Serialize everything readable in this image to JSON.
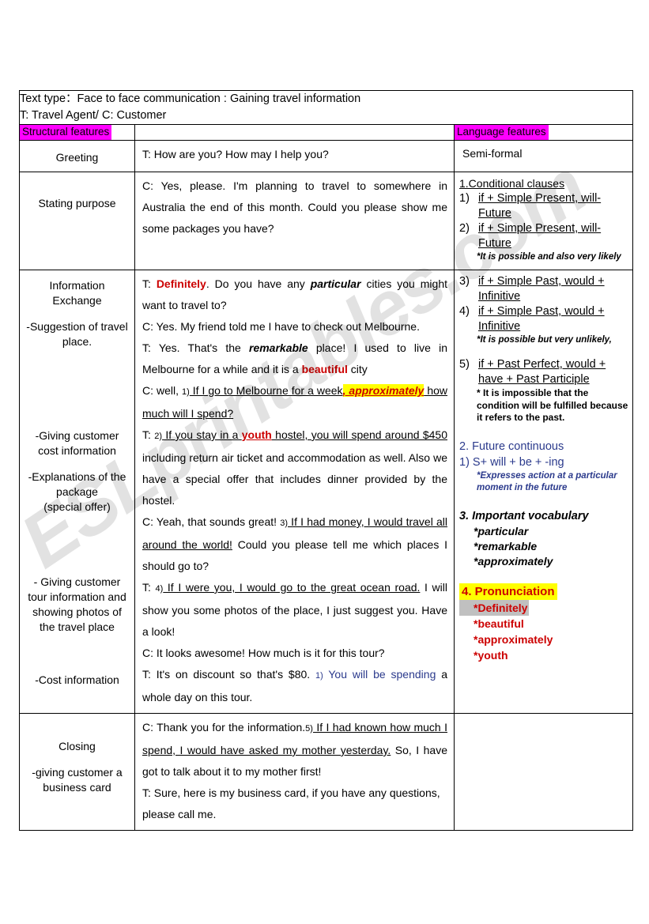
{
  "watermark": {
    "text": "ESLprintables.com"
  },
  "header": {
    "line1": "Text type：Face to face communication : Gaining travel information",
    "line2": "T: Travel Agent/ C: Customer"
  },
  "column_headers": {
    "structural": "Structural features",
    "language": "Language features",
    "highlight_color": "#FF00FF"
  },
  "rows": {
    "greeting": {
      "structural": "Greeting",
      "dialogue": "T: How are you? How may I help you?",
      "language": "Semi-formal"
    },
    "stating_purpose": {
      "structural": "Stating purpose",
      "dialogue": "C: Yes, please. I'm planning to travel to somewhere in Australia the end of this month. Could you please show me some packages you have?"
    },
    "information_exchange": {
      "structural": {
        "title_line1": "Information",
        "title_line2": "Exchange",
        "item1_line1": "-Suggestion of travel",
        "item1_line2": "place.",
        "item2_line1": "-Giving customer",
        "item2_line2": "cost information",
        "item3_line1": "-Explanations of the",
        "item3_line2": "package",
        "item3_line3": "(special offer)",
        "item4_line1": "- Giving customer",
        "item4_line2": "tour information and",
        "item4_line3": "showing photos of",
        "item4_line4": "the travel place",
        "item5": "-Cost information"
      },
      "dialogue": {
        "l1_a": "T: ",
        "l1_definitely": "Definitely",
        "l1_b": ". Do you have any ",
        "l1_particular": "particular",
        "l1_c": " cities you might want to travel to?",
        "l2": "C: Yes. My friend told me I have to check out Melbourne.",
        "l3_a": "T: Yes. That's the ",
        "l3_remarkable": "remarkable",
        "l3_b": " place! I used to live in Melbourne for a while and it is a ",
        "l3_beautiful": "beautiful",
        "l3_c": " city",
        "l4_a": "C: well, ",
        "l4_num": "1)",
        "l4_u1": " If I go to Melbourne for a week",
        "l4_hl": ", approximately",
        "l4_u2": " how much will I spend?",
        "l5_a": "T: ",
        "l5_num": "2)",
        "l5_u1": " If you stay in a ",
        "l5_youth": "youth",
        "l5_u2": " hostel, you will spend around $450",
        "l5_b": " including return air ticket and accommodation as well. Also we have a special offer that includes dinner provided by the hostel.",
        "l6_a": "C: Yeah, that sounds great! ",
        "l6_num": "3)",
        "l6_u": " If I had money, I would travel all around the world!",
        "l6_b": " Could you please tell me which places I should go to?",
        "l7_a": "T: ",
        "l7_num": "4)",
        "l7_u": " If I were you, I would go to the great ocean road.",
        "l7_b": " I will show you some photos of the place, I just suggest you. Have a look!",
        "l8": "C: It looks awesome! How much is it for this tour?",
        "l9_a": "T: It's on discount so that's $80. ",
        "l9_num": "1)",
        "l9_blue": " You will be spending",
        "l9_b": " a whole day on this tour."
      },
      "language": {
        "heading1": "1.Conditional clauses",
        "items": [
          {
            "mark": "1)",
            "text": "if + Simple Present, will-Future"
          },
          {
            "mark": "2)",
            "text": "if + Simple Present, will-Future"
          }
        ],
        "note1": "*It is possible and also very likely",
        "items2": [
          {
            "mark": "3)",
            "text": "if + Simple Past, would + Infinitive"
          },
          {
            "mark": "4)",
            "text": "if + Simple Past, would + Infinitive"
          }
        ],
        "note2": "*It is possible but very unlikely,",
        "items3": [
          {
            "mark": "5)",
            "text": " if + Past Perfect, would + have + Past Participle"
          }
        ],
        "note3": "* It is impossible that the condition will be fulfilled because it refers to the past.",
        "heading2": "2. Future continuous",
        "sub2": "1) S+ will + be + -ing",
        "note4_line1": "*Expresses action at a particular",
        "note4_line2": "moment in the future",
        "heading3": "3. Important vocabulary",
        "vocab": [
          "*particular",
          "*remarkable",
          "*approximately"
        ],
        "heading4": "4. Pronunciation",
        "pron": [
          "*Definitely",
          "*beautiful",
          "*approximately",
          "*youth"
        ],
        "pron_highlight": "#FFFF00",
        "pron_color": "#CC0000",
        "definitely_shade": "#C0C0C0"
      }
    },
    "closing": {
      "structural": {
        "title": "Closing",
        "item1_line1": "-giving customer a",
        "item1_line2": "business card"
      },
      "dialogue": {
        "l1_a": "C: Thank you for the information.",
        "l1_num": "5)",
        "l1_u": " If I had known how much I spend, I would have asked my mother yesterday.",
        "l1_b": " So, I have got to talk about it to my mother first!",
        "l2": "T: Sure, here is my business card, if you have any questions, please call me."
      }
    }
  }
}
